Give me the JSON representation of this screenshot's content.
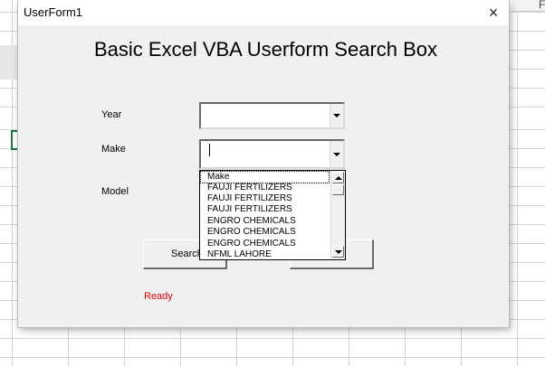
{
  "spreadsheet": {
    "column_header_letter": "F"
  },
  "window": {
    "title": "UserForm1",
    "close_icon": "×"
  },
  "form": {
    "heading": "Basic Excel VBA Userform Search Box",
    "fields": {
      "year_label": "Year",
      "year_value": "",
      "make_label": "Make",
      "make_value": "",
      "model_label": "Model"
    },
    "buttons": {
      "search_label": "Search"
    },
    "status": {
      "text": "Ready",
      "color": "#e00000"
    }
  },
  "make_dropdown": {
    "items": [
      "Make",
      "FAUJI FERTILIZERS",
      "FAUJI FERTILIZERS",
      "FAUJI FERTILIZERS",
      "ENGRO CHEMICALS",
      "ENGRO CHEMICALS",
      "ENGRO CHEMICALS",
      "NFML LAHORE"
    ],
    "selected_index": 0
  }
}
